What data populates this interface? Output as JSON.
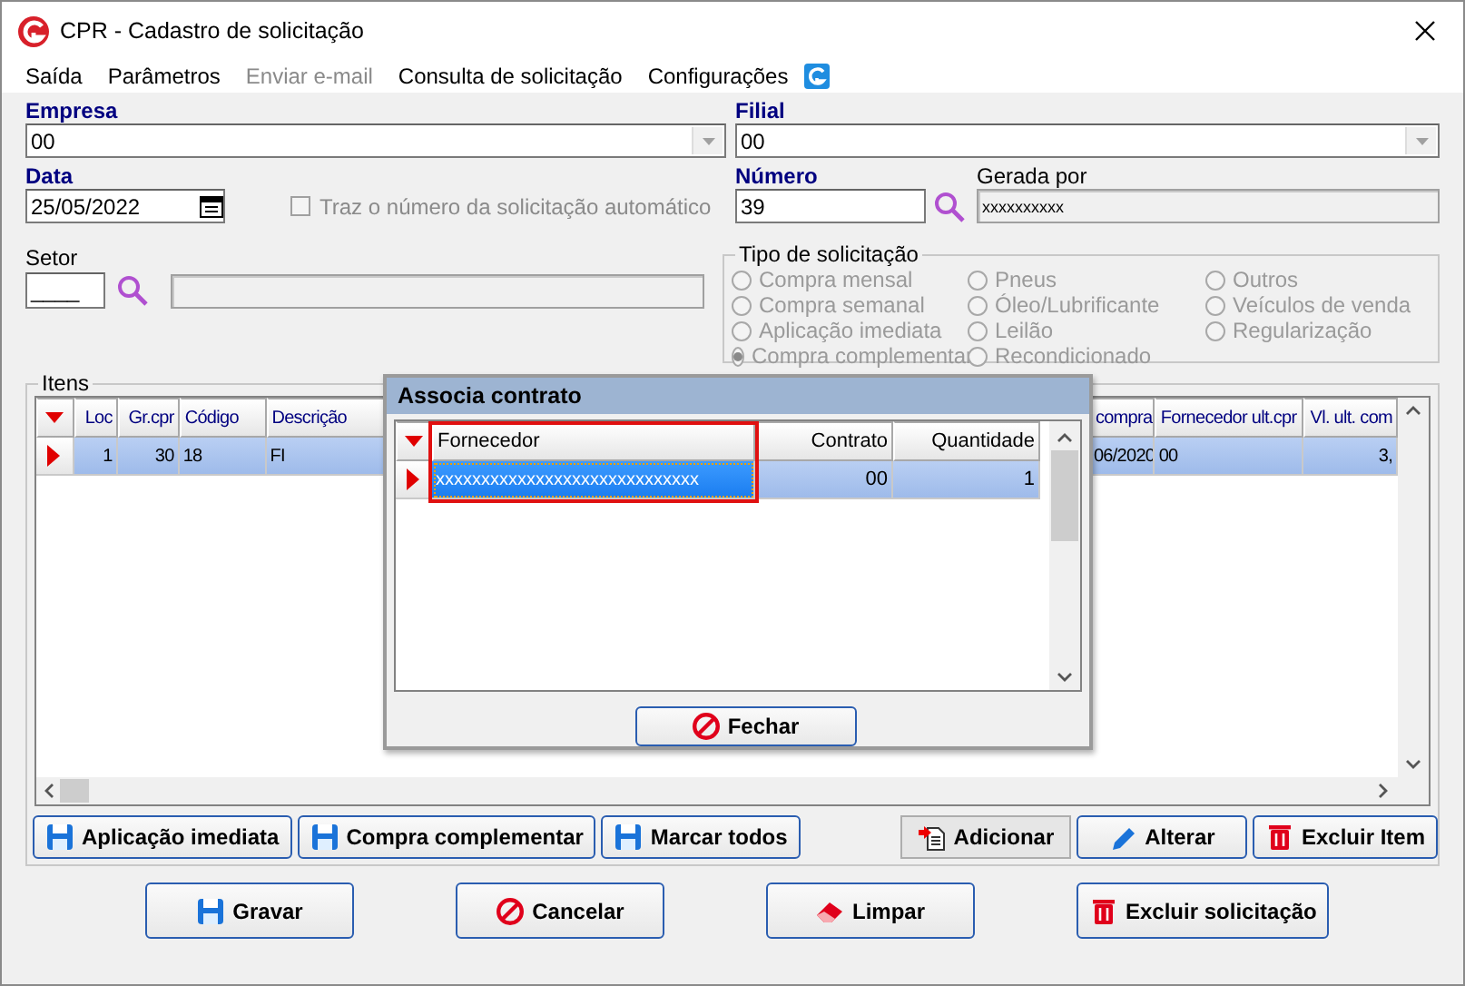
{
  "window": {
    "title": "CPR - Cadastro de solicitação"
  },
  "menu": [
    {
      "label": "Saída",
      "disabled": false
    },
    {
      "label": "Parâmetros",
      "disabled": false
    },
    {
      "label": "Enviar e-mail",
      "disabled": true
    },
    {
      "label": "Consulta de solicitação",
      "disabled": false
    },
    {
      "label": "Configurações",
      "disabled": false
    }
  ],
  "empresa": {
    "label": "Empresa",
    "value": "00"
  },
  "filial": {
    "label": "Filial",
    "value": "00"
  },
  "data": {
    "label": "Data",
    "value": "25/05/2022"
  },
  "auto_number": {
    "label": "Traz o número da solicitação automático",
    "checked": false,
    "disabled": true
  },
  "numero": {
    "label": "Número",
    "value": "39"
  },
  "gerada_por": {
    "label": "Gerada por",
    "value": "xxxxxxxxxx"
  },
  "setor": {
    "label": "Setor",
    "value": "____"
  },
  "tipo_solicitacao": {
    "label": "Tipo de solicitação",
    "disabled": true,
    "options": [
      {
        "label": "Compra mensal",
        "selected": false
      },
      {
        "label": "Compra semanal",
        "selected": false
      },
      {
        "label": "Aplicação imediata",
        "selected": false
      },
      {
        "label": "Compra complementar",
        "selected": true
      },
      {
        "label": "Pneus",
        "selected": false
      },
      {
        "label": "Óleo/Lubrificante",
        "selected": false
      },
      {
        "label": "Leilão",
        "selected": false
      },
      {
        "label": "Recondicionado",
        "selected": false
      },
      {
        "label": "Outros",
        "selected": false
      },
      {
        "label": "Veículos de venda",
        "selected": false
      },
      {
        "label": "Regularização",
        "selected": false
      }
    ]
  },
  "itens": {
    "label": "Itens",
    "columns": [
      {
        "label": "Loc",
        "kind": "number"
      },
      {
        "label": "Gr.cpr",
        "kind": "number"
      },
      {
        "label": "Código",
        "kind": "text"
      },
      {
        "label": "Descrição",
        "kind": "text"
      },
      {
        "label": "compra",
        "kind": "text"
      },
      {
        "label": "Fornecedor ult.cpr",
        "kind": "text"
      },
      {
        "label": "Vl. ult. com",
        "kind": "number"
      }
    ],
    "rows": [
      {
        "selected": true,
        "cells": [
          {
            "text": "1"
          },
          {
            "text": "30"
          },
          {
            "text": "18"
          },
          {
            "text": "FI"
          },
          {
            "text": "06/2020"
          },
          {
            "text": "00"
          },
          {
            "text": "3,"
          }
        ]
      }
    ]
  },
  "left_buttons": [
    {
      "label": "Aplicação imediata",
      "flat": false
    },
    {
      "label": "Compra complementar",
      "flat": false
    },
    {
      "label": "Marcar todos",
      "flat": false
    }
  ],
  "right_buttons": [
    {
      "label": "Adicionar",
      "flat": true
    },
    {
      "label": "Alterar",
      "flat": false
    },
    {
      "label": "Excluir Item",
      "flat": false
    }
  ],
  "footer_buttons": [
    {
      "label": "Gravar",
      "flat": false
    },
    {
      "label": "Cancelar",
      "flat": false
    },
    {
      "label": "Limpar",
      "flat": false
    },
    {
      "label": "Excluir solicitação",
      "flat": false
    }
  ],
  "dialog": {
    "title": "Associa contrato",
    "columns": [
      {
        "label": "Fornecedor",
        "kind": "text",
        "highlighted": true
      },
      {
        "label": "Contrato",
        "kind": "number",
        "highlighted": false
      },
      {
        "label": "Quantidade",
        "kind": "number",
        "highlighted": false
      }
    ],
    "rows": [
      {
        "selected": true,
        "cells": [
          {
            "text": "xxxxxxxxxxxxxxxxxxxxxxxxxxxxx"
          },
          {
            "text": "00"
          },
          {
            "text": "1"
          }
        ]
      }
    ],
    "close_button": {
      "label": "Fechar",
      "flat": false
    }
  }
}
